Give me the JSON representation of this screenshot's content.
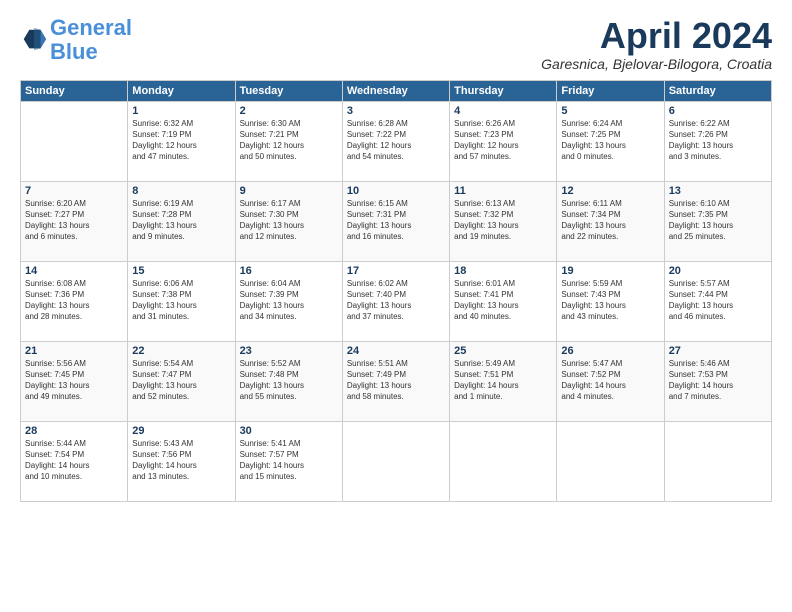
{
  "header": {
    "logo_line1": "General",
    "logo_line2": "Blue",
    "month": "April 2024",
    "location": "Garesnica, Bjelovar-Bilogora, Croatia"
  },
  "weekdays": [
    "Sunday",
    "Monday",
    "Tuesday",
    "Wednesday",
    "Thursday",
    "Friday",
    "Saturday"
  ],
  "weeks": [
    [
      {
        "day": "",
        "info": ""
      },
      {
        "day": "1",
        "info": "Sunrise: 6:32 AM\nSunset: 7:19 PM\nDaylight: 12 hours\nand 47 minutes."
      },
      {
        "day": "2",
        "info": "Sunrise: 6:30 AM\nSunset: 7:21 PM\nDaylight: 12 hours\nand 50 minutes."
      },
      {
        "day": "3",
        "info": "Sunrise: 6:28 AM\nSunset: 7:22 PM\nDaylight: 12 hours\nand 54 minutes."
      },
      {
        "day": "4",
        "info": "Sunrise: 6:26 AM\nSunset: 7:23 PM\nDaylight: 12 hours\nand 57 minutes."
      },
      {
        "day": "5",
        "info": "Sunrise: 6:24 AM\nSunset: 7:25 PM\nDaylight: 13 hours\nand 0 minutes."
      },
      {
        "day": "6",
        "info": "Sunrise: 6:22 AM\nSunset: 7:26 PM\nDaylight: 13 hours\nand 3 minutes."
      }
    ],
    [
      {
        "day": "7",
        "info": "Sunrise: 6:20 AM\nSunset: 7:27 PM\nDaylight: 13 hours\nand 6 minutes."
      },
      {
        "day": "8",
        "info": "Sunrise: 6:19 AM\nSunset: 7:28 PM\nDaylight: 13 hours\nand 9 minutes."
      },
      {
        "day": "9",
        "info": "Sunrise: 6:17 AM\nSunset: 7:30 PM\nDaylight: 13 hours\nand 12 minutes."
      },
      {
        "day": "10",
        "info": "Sunrise: 6:15 AM\nSunset: 7:31 PM\nDaylight: 13 hours\nand 16 minutes."
      },
      {
        "day": "11",
        "info": "Sunrise: 6:13 AM\nSunset: 7:32 PM\nDaylight: 13 hours\nand 19 minutes."
      },
      {
        "day": "12",
        "info": "Sunrise: 6:11 AM\nSunset: 7:34 PM\nDaylight: 13 hours\nand 22 minutes."
      },
      {
        "day": "13",
        "info": "Sunrise: 6:10 AM\nSunset: 7:35 PM\nDaylight: 13 hours\nand 25 minutes."
      }
    ],
    [
      {
        "day": "14",
        "info": "Sunrise: 6:08 AM\nSunset: 7:36 PM\nDaylight: 13 hours\nand 28 minutes."
      },
      {
        "day": "15",
        "info": "Sunrise: 6:06 AM\nSunset: 7:38 PM\nDaylight: 13 hours\nand 31 minutes."
      },
      {
        "day": "16",
        "info": "Sunrise: 6:04 AM\nSunset: 7:39 PM\nDaylight: 13 hours\nand 34 minutes."
      },
      {
        "day": "17",
        "info": "Sunrise: 6:02 AM\nSunset: 7:40 PM\nDaylight: 13 hours\nand 37 minutes."
      },
      {
        "day": "18",
        "info": "Sunrise: 6:01 AM\nSunset: 7:41 PM\nDaylight: 13 hours\nand 40 minutes."
      },
      {
        "day": "19",
        "info": "Sunrise: 5:59 AM\nSunset: 7:43 PM\nDaylight: 13 hours\nand 43 minutes."
      },
      {
        "day": "20",
        "info": "Sunrise: 5:57 AM\nSunset: 7:44 PM\nDaylight: 13 hours\nand 46 minutes."
      }
    ],
    [
      {
        "day": "21",
        "info": "Sunrise: 5:56 AM\nSunset: 7:45 PM\nDaylight: 13 hours\nand 49 minutes."
      },
      {
        "day": "22",
        "info": "Sunrise: 5:54 AM\nSunset: 7:47 PM\nDaylight: 13 hours\nand 52 minutes."
      },
      {
        "day": "23",
        "info": "Sunrise: 5:52 AM\nSunset: 7:48 PM\nDaylight: 13 hours\nand 55 minutes."
      },
      {
        "day": "24",
        "info": "Sunrise: 5:51 AM\nSunset: 7:49 PM\nDaylight: 13 hours\nand 58 minutes."
      },
      {
        "day": "25",
        "info": "Sunrise: 5:49 AM\nSunset: 7:51 PM\nDaylight: 14 hours\nand 1 minute."
      },
      {
        "day": "26",
        "info": "Sunrise: 5:47 AM\nSunset: 7:52 PM\nDaylight: 14 hours\nand 4 minutes."
      },
      {
        "day": "27",
        "info": "Sunrise: 5:46 AM\nSunset: 7:53 PM\nDaylight: 14 hours\nand 7 minutes."
      }
    ],
    [
      {
        "day": "28",
        "info": "Sunrise: 5:44 AM\nSunset: 7:54 PM\nDaylight: 14 hours\nand 10 minutes."
      },
      {
        "day": "29",
        "info": "Sunrise: 5:43 AM\nSunset: 7:56 PM\nDaylight: 14 hours\nand 13 minutes."
      },
      {
        "day": "30",
        "info": "Sunrise: 5:41 AM\nSunset: 7:57 PM\nDaylight: 14 hours\nand 15 minutes."
      },
      {
        "day": "",
        "info": ""
      },
      {
        "day": "",
        "info": ""
      },
      {
        "day": "",
        "info": ""
      },
      {
        "day": "",
        "info": ""
      }
    ]
  ]
}
